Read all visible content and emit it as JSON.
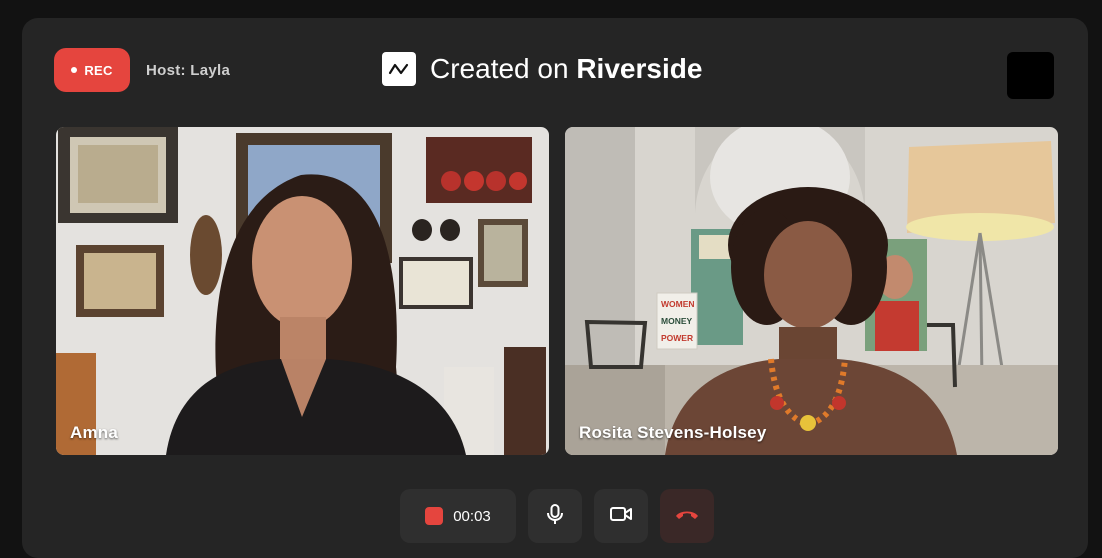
{
  "header": {
    "rec_label": "REC",
    "host_label": "Host: Layla",
    "brand_prefix": "Created on ",
    "brand_name": "Riverside"
  },
  "participants": [
    {
      "name": "Amna"
    },
    {
      "name": "Rosita Stevens-Holsey"
    }
  ],
  "controls": {
    "timer": "00:03"
  },
  "books": {
    "title_lines": [
      "WOMEN",
      "MONEY",
      "POWER"
    ]
  },
  "colors": {
    "accent_red": "#e5453e",
    "panel_bg": "#252525",
    "page_bg": "#121212",
    "button_bg": "#2f2f2f"
  }
}
